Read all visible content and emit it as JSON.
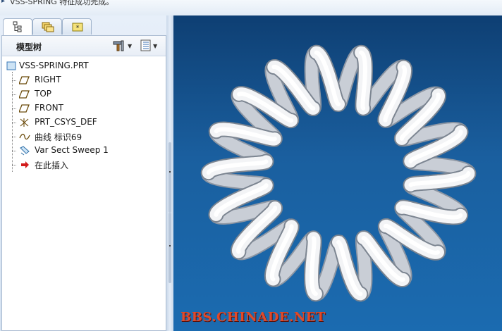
{
  "status_bar": {
    "message": "VSS-SPRING 特征成功完成。"
  },
  "tabs": [
    {
      "name": "model-tree-tab",
      "icon": "model-tree-icon",
      "active": true
    },
    {
      "name": "folder-browser-tab",
      "icon": "folders-icon",
      "active": false
    },
    {
      "name": "favorites-tab",
      "icon": "star-folder-icon",
      "active": false
    }
  ],
  "panel": {
    "title": "模型树",
    "settings_icon": "tools-icon",
    "show_icon": "tree-columns-icon"
  },
  "tree": {
    "root": {
      "label": "VSS-SPRING.PRT",
      "icon": "part-icon"
    },
    "items": [
      {
        "label": "RIGHT",
        "icon": "datum-plane-icon"
      },
      {
        "label": "TOP",
        "icon": "datum-plane-icon"
      },
      {
        "label": "FRONT",
        "icon": "datum-plane-icon"
      },
      {
        "label": "PRT_CSYS_DEF",
        "icon": "csys-icon"
      },
      {
        "label": "曲线 标识69",
        "icon": "curve-icon"
      },
      {
        "label": "Var Sect Sweep 1",
        "icon": "sweep-icon"
      },
      {
        "label": "在此插入",
        "icon": "insert-here-arrow-icon"
      }
    ]
  },
  "viewport": {
    "model": "toroidal-spring",
    "watermark": "BBS.CHINADE.NET",
    "colors": {
      "background_top": "#0e3f73",
      "background_bottom": "#1b6bb0",
      "model": "#f2f2f2",
      "watermark": "#e04a2a"
    }
  }
}
